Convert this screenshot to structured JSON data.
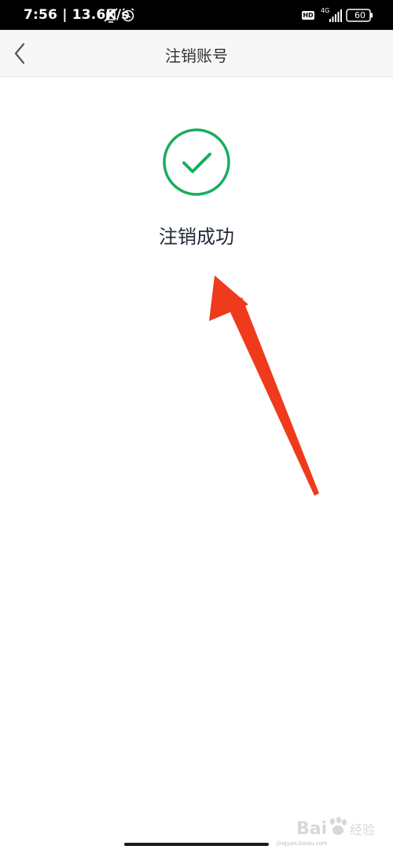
{
  "status_bar": {
    "time": "7:56 | 13.6K/s",
    "hd_label": "HD",
    "network_label": "4G",
    "battery_level": "60",
    "icons": [
      "mute-notification-icon",
      "alarm-icon",
      "hd-icon",
      "signal-icon",
      "battery-icon"
    ]
  },
  "nav": {
    "title": "注销账号",
    "back_icon": "chevron-left-icon"
  },
  "result": {
    "status_text": "注销成功",
    "icon": "check-circle-icon",
    "accent_color": "#1aad5f"
  },
  "annotation": {
    "arrow_color": "#f03a1c"
  },
  "watermark": {
    "brand_text": "Bai",
    "brand_suffix": "经验",
    "url": "jingyan.baidu.com"
  }
}
